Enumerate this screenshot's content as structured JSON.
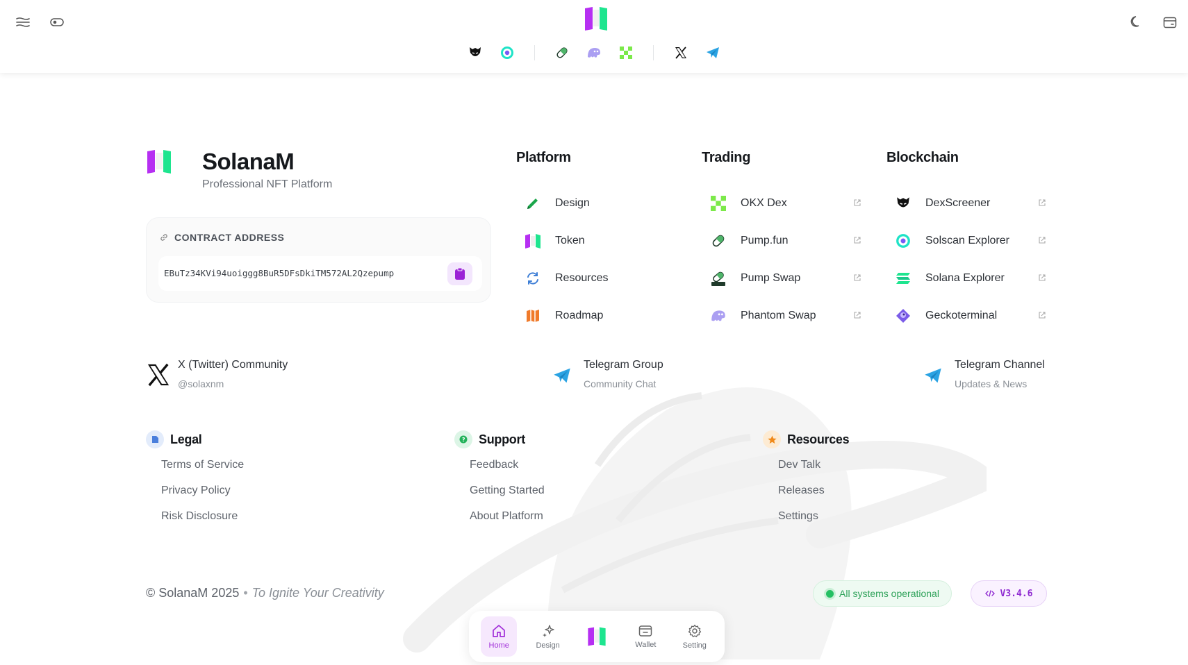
{
  "brand": {
    "name": "SolanaM",
    "tagline": "Professional NFT Platform",
    "colors": {
      "purple": "#b62ff2",
      "green": "#1ee58f",
      "accent": "#a12ed9"
    }
  },
  "header": {
    "left_icons": [
      "menu-icon",
      "toggle-icon"
    ],
    "right_icons": [
      "moon-icon",
      "wallet-card-icon"
    ],
    "quick_links": [
      "dexscreener-icon",
      "solscan-icon",
      "pumpfun-icon",
      "phantom-icon",
      "okx-icon",
      "x-icon",
      "telegram-icon"
    ]
  },
  "contract": {
    "label": "CONTRACT ADDRESS",
    "address": "EBuTz34KVi94uoiggg8BuR5DFsDkiTM572AL2Qzepump"
  },
  "platform": {
    "title": "Platform",
    "items": [
      {
        "label": "Design",
        "icon": "pencil-icon"
      },
      {
        "label": "Token",
        "icon": "token-logo-icon"
      },
      {
        "label": "Resources",
        "icon": "refresh-icon"
      },
      {
        "label": "Roadmap",
        "icon": "map-icon"
      }
    ]
  },
  "trading": {
    "title": "Trading",
    "items": [
      {
        "label": "OKX Dex",
        "icon": "okx-icon"
      },
      {
        "label": "Pump.fun",
        "icon": "pill-icon"
      },
      {
        "label": "Pump Swap",
        "icon": "pumpswap-icon"
      },
      {
        "label": "Phantom Swap",
        "icon": "phantom-icon"
      }
    ]
  },
  "blockchain": {
    "title": "Blockchain",
    "items": [
      {
        "label": "DexScreener",
        "icon": "dexscreener-icon"
      },
      {
        "label": "Solscan Explorer",
        "icon": "solscan-icon"
      },
      {
        "label": "Solana Explorer",
        "icon": "solana-icon"
      },
      {
        "label": "Geckoterminal",
        "icon": "gecko-icon"
      }
    ]
  },
  "community": {
    "x": {
      "title": "X (Twitter) Community",
      "sub": "@solaxnm"
    },
    "tg_group": {
      "title": "Telegram Group",
      "sub": "Community Chat"
    },
    "tg_channel": {
      "title": "Telegram Channel",
      "sub": "Updates & News"
    }
  },
  "legal": {
    "title": "Legal",
    "links": [
      "Terms of Service",
      "Privacy Policy",
      "Risk Disclosure"
    ]
  },
  "support": {
    "title": "Support",
    "links": [
      "Feedback",
      "Getting Started",
      "About Platform"
    ]
  },
  "resources": {
    "title": "Resources",
    "links": [
      "Dev Talk",
      "Releases",
      "Settings"
    ]
  },
  "footer": {
    "copyright": "© SolanaM 2025",
    "slogan": "To Ignite Your Creativity",
    "status": "All systems operational",
    "version": "V3.4.6"
  },
  "bottom_nav": {
    "home": "Home",
    "design": "Design",
    "wallet": "Wallet",
    "setting": "Setting",
    "active": "Home"
  }
}
